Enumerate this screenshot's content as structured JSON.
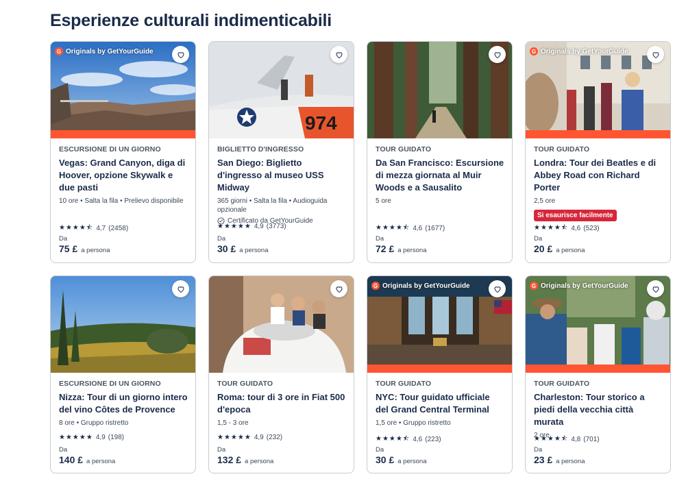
{
  "section_title": "Esperienze culturali indimenticabili",
  "originals_label": "Originals by GetYourGuide",
  "from_label": "Da",
  "per_person": "a persona",
  "cards": [
    {
      "category": "ESCURSIONE DI UN GIORNO",
      "title": "Vegas: Grand Canyon, diga di Hoover, opzione Skywalk e due pasti",
      "meta": "10 ore • Salta la fila • Prelievo disponibile",
      "rating": "4,7",
      "reviews": "(2458)",
      "price": "75 £",
      "originals": true
    },
    {
      "category": "BIGLIETTO D'INGRESSO",
      "title": "San Diego: Biglietto d'ingresso al museo USS Midway",
      "meta": "365 giorni • Salta la fila • Audioguida opzionale",
      "certified": "Certificato da GetYourGuide",
      "rating": "4,9",
      "reviews": "(3773)",
      "price": "30 £",
      "originals": false
    },
    {
      "category": "TOUR GUIDATO",
      "title": "Da San Francisco: Escursione di mezza giornata al Muir Woods e a Sausalito",
      "meta": "5 ore",
      "rating": "4,6",
      "reviews": "(1677)",
      "price": "72 £",
      "originals": false
    },
    {
      "category": "TOUR GUIDATO",
      "title": "Londra: Tour dei Beatles e di Abbey Road con Richard Porter",
      "meta": "2,5 ore",
      "soldout": "Si esaurisce facilmente",
      "rating": "4,6",
      "reviews": "(523)",
      "price": "20 £",
      "originals": true
    },
    {
      "category": "ESCURSIONE DI UN GIORNO",
      "title": "Nizza: Tour di un giorno intero del vino Côtes de Provence",
      "meta": "8 ore • Gruppo ristretto",
      "rating": "4,9",
      "reviews": "(198)",
      "price": "140 £",
      "originals": false
    },
    {
      "category": "TOUR GUIDATO",
      "title": "Roma: tour di 3 ore in Fiat 500 d'epoca",
      "meta": "1,5 - 3 ore",
      "rating": "4,9",
      "reviews": "(232)",
      "price": "132 £",
      "originals": false
    },
    {
      "category": "TOUR GUIDATO",
      "title": "NYC: Tour guidato ufficiale del Grand Central Terminal",
      "meta": "1,5 ore • Gruppo ristretto",
      "rating": "4,6",
      "reviews": "(223)",
      "price": "30 £",
      "originals": true
    },
    {
      "category": "TOUR GUIDATO",
      "title": "Charleston: Tour storico a piedi della vecchia città murata",
      "meta": "2 ore",
      "rating": "4,8",
      "reviews": "(701)",
      "price": "23 £",
      "originals": true
    }
  ]
}
